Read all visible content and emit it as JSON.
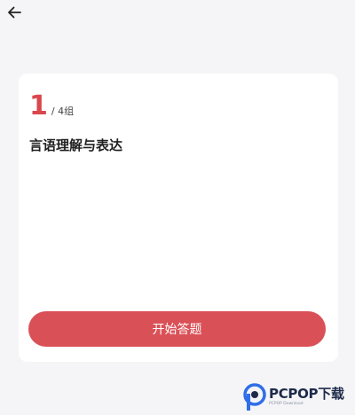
{
  "header": {
    "back_icon": "arrow-left-icon"
  },
  "card": {
    "progress_current": "1",
    "progress_total": "/ 4组",
    "section_title": "言语理解与表达"
  },
  "actions": {
    "start_label": "开始答题"
  },
  "watermark": {
    "brand": "PCPOP下载",
    "sub": "PCPOP Download"
  },
  "colors": {
    "accent": "#da5057",
    "progress": "#d9474d",
    "background": "#f5f5f7",
    "card": "#ffffff"
  }
}
